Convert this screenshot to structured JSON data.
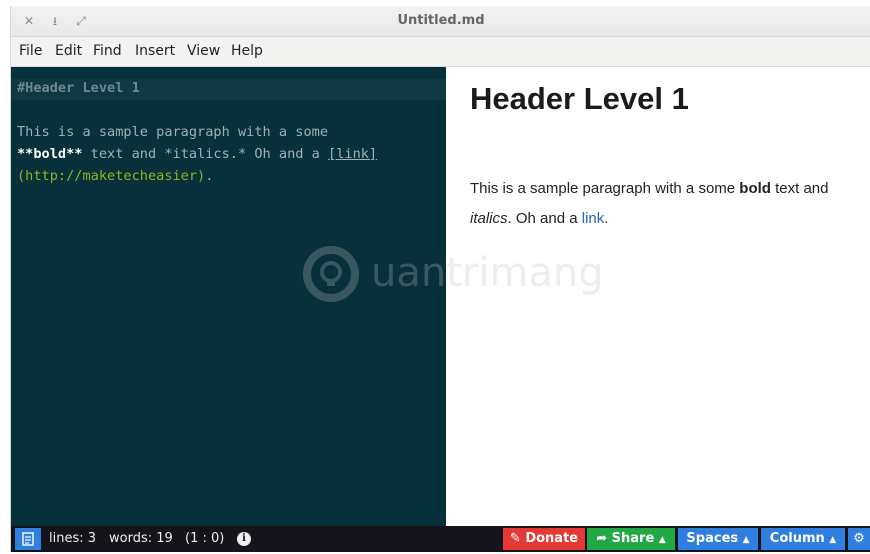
{
  "window": {
    "title": "Untitled.md",
    "controls": [
      {
        "name": "close-icon",
        "glyph": "✕"
      },
      {
        "name": "minimize-icon",
        "glyph": "⭳"
      },
      {
        "name": "maximize-icon",
        "glyph": "⤢"
      }
    ]
  },
  "menu": {
    "items": [
      "File",
      "Edit",
      "Find",
      "Insert",
      "View",
      "Help"
    ]
  },
  "editor": {
    "header_line": "#Header Level 1",
    "para_line1": "This is a sample paragraph with a some",
    "para_line2_bold": "**bold**",
    "para_line2_rest": " text and *italics.* Oh and a ",
    "para_line2_link": "[link]",
    "para_line3_url": "(http://maketecheasier)",
    "para_line3_end": ".",
    "colors": {
      "background": "#06303a",
      "text": "#9fb2b5",
      "header": "#6b8a8f",
      "bold": "#ffffff",
      "url": "#8fb61e"
    }
  },
  "preview": {
    "heading": "Header Level 1",
    "p_line1_a": "This is a sample paragraph with a some ",
    "p_line1_bold": "bold",
    "p_line1_b": " text and",
    "p_line2_italic": "italics",
    "p_line2_a": ". Oh and a ",
    "p_line2_link": "link",
    "p_line2_end": ".",
    "link_color": "#2b62b8"
  },
  "statusbar": {
    "lines": "lines: 3",
    "words": "words: 19",
    "cursor": "(1 : 0)",
    "info_icon": "info-icon",
    "buttons": {
      "donate": "Donate",
      "share": "Share",
      "spaces": "Spaces",
      "column": "Column"
    },
    "colors": {
      "donate": "#e53935",
      "share": "#22a845",
      "spaces": "#2f7ee0",
      "column": "#2f7ee0",
      "settings": "#2f7ee0"
    }
  },
  "watermark": {
    "text": "uantrimang"
  }
}
